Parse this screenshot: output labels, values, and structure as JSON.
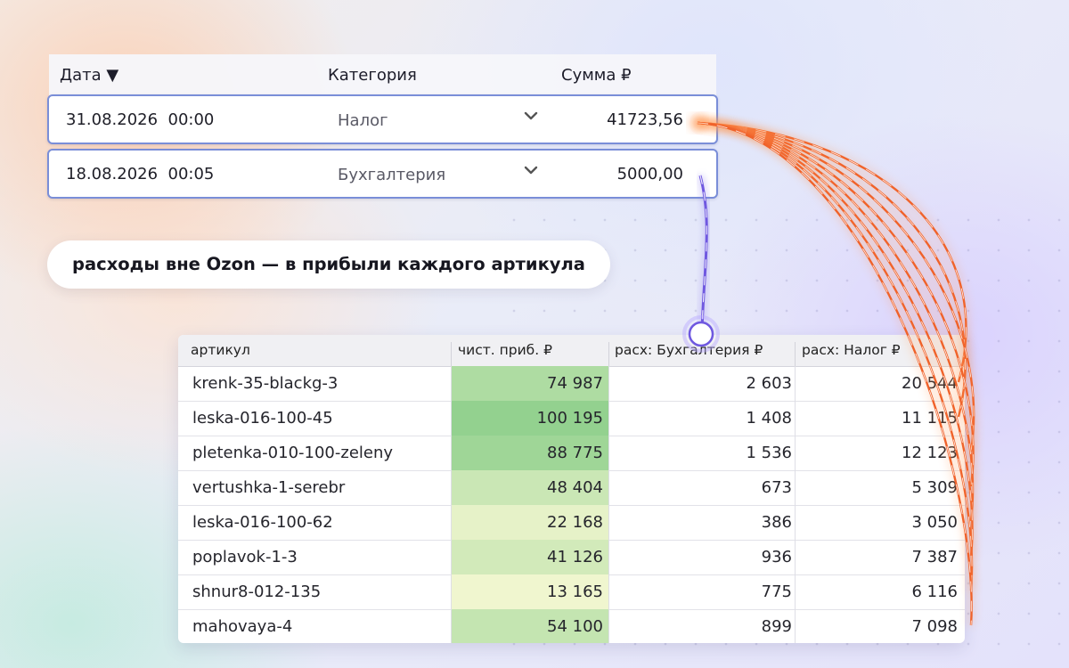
{
  "expenses": {
    "headers": {
      "date": "Дата ▼",
      "category": "Категория",
      "amount": "Сумма ₽"
    },
    "rows": [
      {
        "datetime": "31.08.2026  00:00",
        "category": "Налог",
        "amount": "41723,56"
      },
      {
        "datetime": "18.08.2026  00:05",
        "category": "Бухгалтерия",
        "amount": "5000,00"
      }
    ]
  },
  "caption": "расходы вне Ozon — в прибыли каждого артикула",
  "products": {
    "columns": [
      "артикул",
      "чист. приб. ₽",
      "расх: Бухгалтерия ₽",
      "расх: Налог ₽"
    ],
    "rows": [
      {
        "sku": "krenk-35-blackg-3",
        "profit": "74 987",
        "accounting": "2 603",
        "tax": "20 544"
      },
      {
        "sku": "leska-016-100-45",
        "profit": "100 195",
        "accounting": "1 408",
        "tax": "11 115"
      },
      {
        "sku": "pletenka-010-100-zeleny",
        "profit": "88 775",
        "accounting": "1 536",
        "tax": "12 123"
      },
      {
        "sku": "vertushka-1-serebr",
        "profit": "48 404",
        "accounting": "673",
        "tax": "5 309"
      },
      {
        "sku": "leska-016-100-62",
        "profit": "22 168",
        "accounting": "386",
        "tax": "3 050"
      },
      {
        "sku": "poplavok-1-3",
        "profit": "41 126",
        "accounting": "936",
        "tax": "7 387"
      },
      {
        "sku": "shnur8-012-135",
        "profit": "13 165",
        "accounting": "775",
        "tax": "6 116"
      },
      {
        "sku": "mahovaya-4",
        "profit": "54 100",
        "accounting": "899",
        "tax": "7 098"
      }
    ]
  },
  "colors": {
    "tax_flow": "#f0622a",
    "accounting_flow": "#6f58e0",
    "profit_high": "#93d18f",
    "profit_low": "#f0f6cf"
  },
  "icons": {
    "dropdown": "chevron-down-icon",
    "sort": "sort-desc-icon"
  }
}
